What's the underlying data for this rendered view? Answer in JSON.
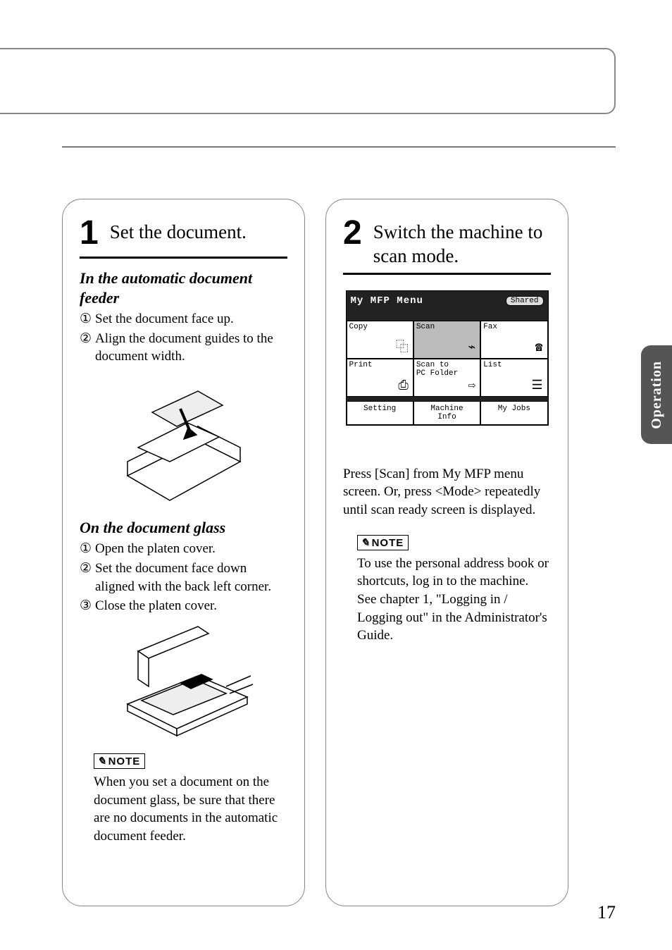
{
  "side_tab": "Operation",
  "page_number": "17",
  "step1": {
    "number": "1",
    "title": "Set the document.",
    "adf": {
      "heading": "In the automatic document feeder",
      "items": [
        "Set the document face up.",
        "Align the document guides to the document width."
      ]
    },
    "glass": {
      "heading": "On the document glass",
      "items": [
        "Open the platen cover.",
        "Set the document face down aligned with the back left corner.",
        "Close the  platen cover."
      ]
    },
    "note_label": "NOTE",
    "note_text": "When you set a document on the document glass, be sure that there are no documents in the automatic document feeder."
  },
  "step2": {
    "number": "2",
    "title": "Switch the machine to scan mode.",
    "screen": {
      "title": "My MFP Menu",
      "shared": "Shared",
      "cells": [
        "Copy",
        "Scan",
        "Fax",
        "Print",
        "Scan to\nPC Folder",
        "List"
      ],
      "footer": [
        "Setting",
        "Machine\nInfo",
        "My Jobs"
      ]
    },
    "instruction": "Press [Scan] from My MFP menu screen.  Or, press <Mode> repeatedly until scan ready screen is displayed.",
    "note_label": "NOTE",
    "note_text": "To use the personal address book or shortcuts, log in to the machine.  See chapter 1, \"Logging in / Logging out\" in the Administrator's Guide."
  },
  "circled": [
    "①",
    "②",
    "③"
  ]
}
